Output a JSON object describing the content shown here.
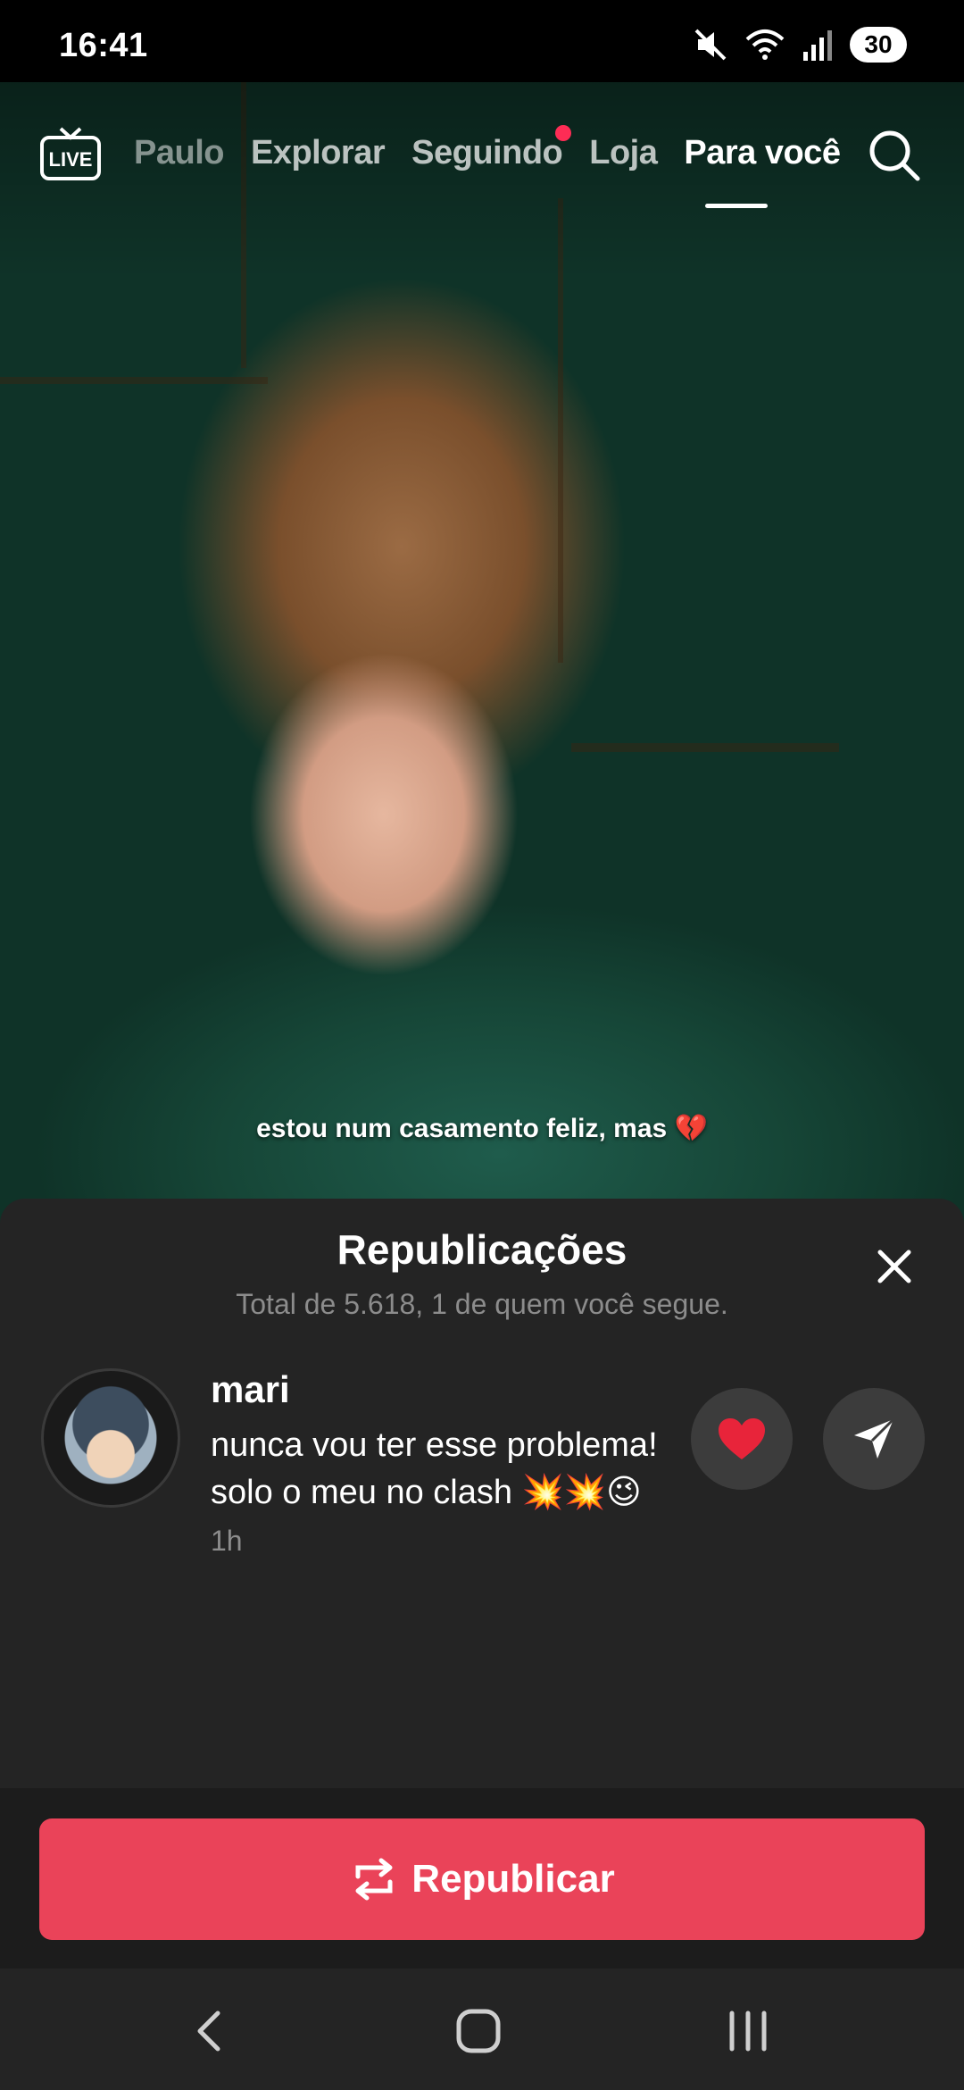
{
  "status_bar": {
    "time": "16:41",
    "battery": "30"
  },
  "top_nav": {
    "live_label": "LIVE",
    "tabs": [
      {
        "label": "Paulo",
        "state": "faded"
      },
      {
        "label": "Explorar",
        "state": "inactive"
      },
      {
        "label": "Seguindo",
        "state": "inactive",
        "notification_dot": true
      },
      {
        "label": "Loja",
        "state": "inactive"
      },
      {
        "label": "Para você",
        "state": "active"
      }
    ]
  },
  "video": {
    "caption": "estou num casamento feliz, mas 💔"
  },
  "sheet": {
    "title": "Republicações",
    "subtitle": "Total de 5.618, 1 de quem você segue.",
    "reposts": [
      {
        "username": "mari",
        "comment": "nunca vou ter esse problema! solo o meu no clash 💥💥😉",
        "time": "1h"
      }
    ],
    "repost_button": "Republicar"
  },
  "colors": {
    "accent": "#ea4359",
    "notification_dot": "#fe2c55",
    "sheet_bg": "#242424",
    "subtitle": "#8c8c8c"
  },
  "icons": {
    "live": "live-tv-icon",
    "search": "search-icon",
    "close": "close-icon",
    "like": "heart-icon",
    "send": "send-icon",
    "repost": "repost-icon",
    "nav_back": "back-chevron-icon",
    "nav_home": "home-icon",
    "nav_recents": "recents-icon"
  }
}
